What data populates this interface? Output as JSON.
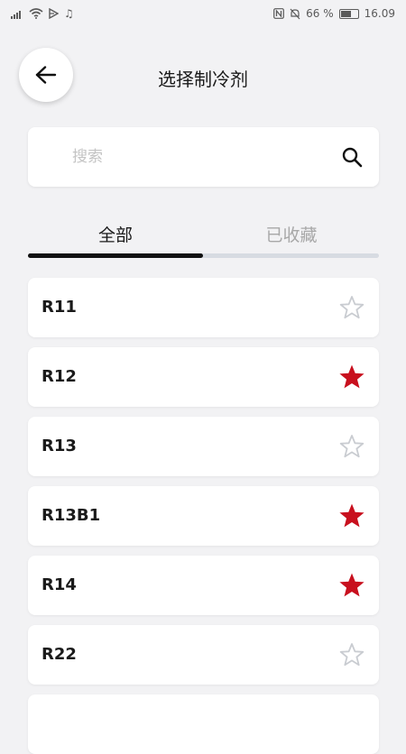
{
  "status_bar": {
    "right_text": "66 %",
    "time": "16.09",
    "battery_level": 0.66
  },
  "header": {
    "title": "选择制冷剂",
    "back_icon": "arrow-left-icon"
  },
  "search": {
    "placeholder": "搜索",
    "value": "",
    "icon": "search-icon"
  },
  "tabs": [
    {
      "label": "全部",
      "active": true
    },
    {
      "label": "已收藏",
      "active": false
    }
  ],
  "colors": {
    "star_filled": "#c8101e",
    "star_outline": "#c9ccd1",
    "background": "#f2f2f4"
  },
  "refrigerants": [
    {
      "name": "R11",
      "favorite": false
    },
    {
      "name": "R12",
      "favorite": true
    },
    {
      "name": "R13",
      "favorite": false
    },
    {
      "name": "R13B1",
      "favorite": true
    },
    {
      "name": "R14",
      "favorite": true
    },
    {
      "name": "R22",
      "favorite": false
    },
    {
      "name": "",
      "favorite": false
    }
  ]
}
